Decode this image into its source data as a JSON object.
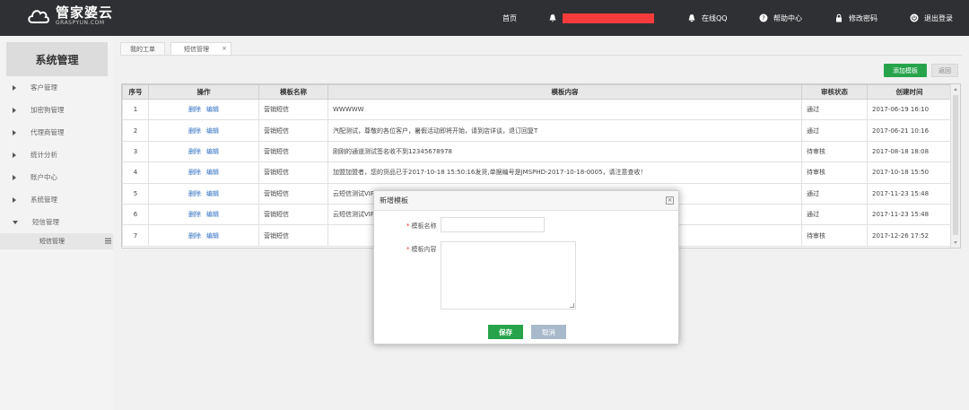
{
  "header": {
    "logo_title": "管家婆云",
    "logo_sub": "GRASPYUN.COM",
    "nav": {
      "home": "首页",
      "online_qq": "在线QQ",
      "help": "帮助中心",
      "change_password": "修改密码",
      "logout": "退出登录"
    },
    "notification_redacted_color": "#f53b3b"
  },
  "sidebar": {
    "title": "系统管理",
    "items": [
      {
        "label": "客户管理",
        "expanded": false
      },
      {
        "label": "加密狗管理",
        "expanded": false
      },
      {
        "label": "代理商管理",
        "expanded": false
      },
      {
        "label": "统计分析",
        "expanded": false
      },
      {
        "label": "账户中心",
        "expanded": false
      },
      {
        "label": "系统管理",
        "expanded": false
      },
      {
        "label": "短信管理",
        "expanded": true
      }
    ],
    "sub_item": "短信管理"
  },
  "tabs": {
    "my_orders": "我的工单",
    "sms_manage": "短信管理",
    "close": "×"
  },
  "toolbar": {
    "add_template": "添加模板",
    "back": "返回",
    "accent": "#27a44b"
  },
  "table": {
    "headers": [
      "序号",
      "操作",
      "模板名称",
      "模板内容",
      "审核状态",
      "创建时间"
    ],
    "action_delete": "删除",
    "action_edit": "编辑",
    "rows": [
      {
        "no": "1",
        "name": "营销短信",
        "content": "WWWWW",
        "status": "通过",
        "created": "2017-06-19 16:10"
      },
      {
        "no": "2",
        "name": "营销短信",
        "content": "汽配测试，尊敬的各位客户，暑假活动即将开始，请到店详谈，退订回复T",
        "status": "通过",
        "created": "2017-06-21 10:16"
      },
      {
        "no": "3",
        "name": "营销短信",
        "content": "刚刚的通道测试签名收不到12345678978",
        "status": "待审核",
        "created": "2017-08-18 18:08"
      },
      {
        "no": "4",
        "name": "营销短信",
        "content": "加盟加盟者，您的货品已于2017-10-18 15:50:16发货,单据编号是JMSPHD-2017-10-18-0005，请注意查收！",
        "status": "待审核",
        "created": "2017-10-18 15:50"
      },
      {
        "no": "5",
        "name": "营销短信",
        "content": "云短信测试VIP",
        "status": "通过",
        "created": "2017-11-23 15:48"
      },
      {
        "no": "6",
        "name": "营销短信",
        "content": "云短信测试VIP",
        "status": "通过",
        "created": "2017-11-23 15:48"
      },
      {
        "no": "7",
        "name": "营销短信",
        "content": "",
        "status": "待审核",
        "created": "2017-12-26 17:52"
      }
    ]
  },
  "modal": {
    "title": "新增模板",
    "close": "×",
    "field_name_label": "模板名称",
    "field_content_label": "模板内容",
    "required_mark": "*",
    "name_value": "",
    "content_value": "",
    "save": "保存",
    "cancel": "取消"
  }
}
